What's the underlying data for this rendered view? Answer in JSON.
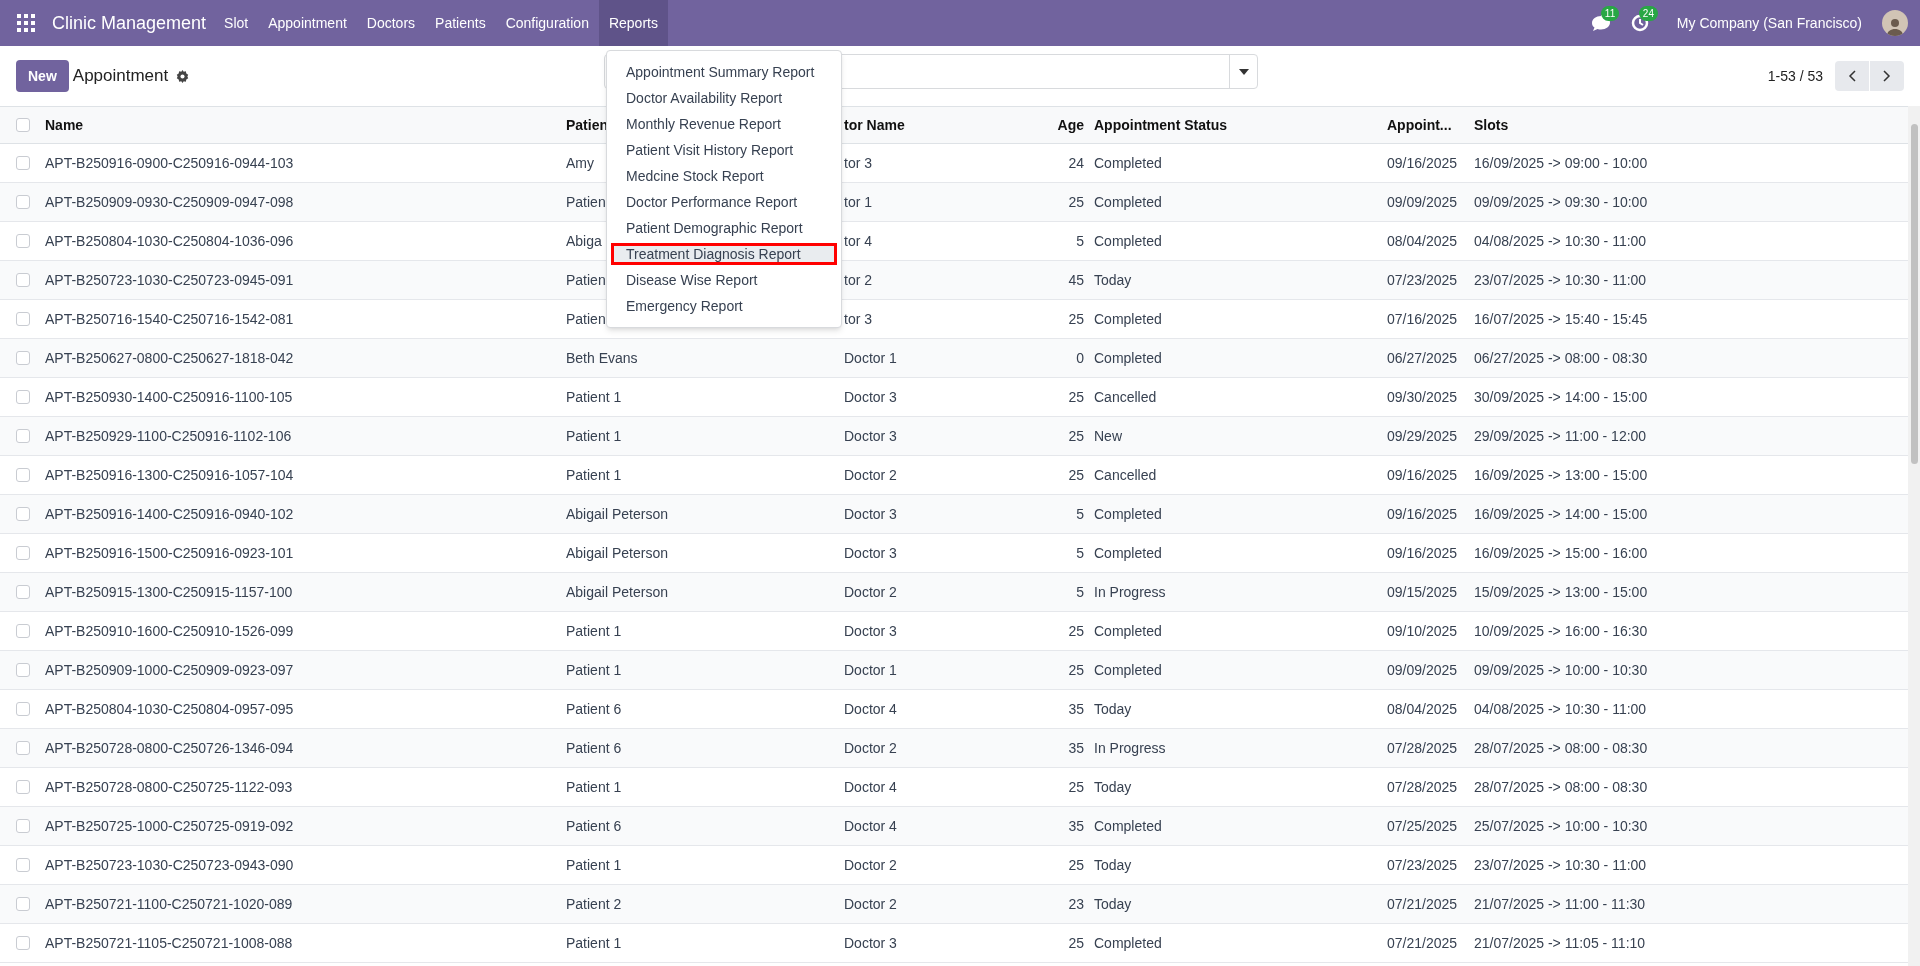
{
  "navbar": {
    "app_name": "Clinic Management",
    "menus": [
      {
        "label": "Slot",
        "selected": false
      },
      {
        "label": "Appointment",
        "selected": false
      },
      {
        "label": "Doctors",
        "selected": false
      },
      {
        "label": "Patients",
        "selected": false
      },
      {
        "label": "Configuration",
        "selected": false
      },
      {
        "label": "Reports",
        "selected": true
      }
    ],
    "messages_count": "11",
    "activities_count": "24",
    "company": "My Company (San Francisco)"
  },
  "reports_menu": {
    "open": true,
    "items": [
      {
        "label": "Appointment Summary Report",
        "selected": false
      },
      {
        "label": "Doctor Availability Report",
        "selected": false
      },
      {
        "label": "Monthly Revenue Report",
        "selected": false
      },
      {
        "label": "Patient Visit History Report",
        "selected": false
      },
      {
        "label": "Medcine Stock Report",
        "selected": false
      },
      {
        "label": "Doctor Performance Report",
        "selected": false
      },
      {
        "label": "Patient Demographic Report",
        "selected": false
      },
      {
        "label": "Treatment Diagnosis Report",
        "selected": true
      },
      {
        "label": "Disease Wise Report",
        "selected": false
      },
      {
        "label": "Emergency Report",
        "selected": false
      }
    ]
  },
  "control_panel": {
    "new_button": "New",
    "breadcrumb": "Appointment",
    "pager": "1-53 / 53"
  },
  "table": {
    "all_checked": false,
    "columns": [
      "Name",
      "Patien",
      "tor Name",
      "Age",
      "Appointment Status",
      "Appoint...",
      "Slots"
    ],
    "rows": [
      {
        "checked": false,
        "cells": [
          "APT-B250916-0900-C250916-0944-103",
          "Amy",
          "tor 3",
          "24",
          "Completed",
          "09/16/2025",
          "16/09/2025 -> 09:00 - 10:00"
        ]
      },
      {
        "checked": false,
        "cells": [
          "APT-B250909-0930-C250909-0947-098",
          "Patien",
          "tor 1",
          "25",
          "Completed",
          "09/09/2025",
          "09/09/2025 -> 09:30 - 10:00"
        ]
      },
      {
        "checked": false,
        "cells": [
          "APT-B250804-1030-C250804-1036-096",
          "Abiga",
          "tor 4",
          "5",
          "Completed",
          "08/04/2025",
          "04/08/2025 -> 10:30 - 11:00"
        ]
      },
      {
        "checked": false,
        "cells": [
          "APT-B250723-1030-C250723-0945-091",
          "Patien",
          "tor 2",
          "45",
          "Today",
          "07/23/2025",
          "23/07/2025 -> 10:30 - 11:00"
        ]
      },
      {
        "checked": false,
        "cells": [
          "APT-B250716-1540-C250716-1542-081",
          "Patien",
          "tor 3",
          "25",
          "Completed",
          "07/16/2025",
          "16/07/2025 -> 15:40 - 15:45"
        ]
      },
      {
        "checked": false,
        "cells": [
          "APT-B250627-0800-C250627-1818-042",
          "Beth Evans",
          "Doctor 1",
          "0",
          "Completed",
          "06/27/2025",
          "06/27/2025 -> 08:00 - 08:30"
        ]
      },
      {
        "checked": false,
        "cells": [
          "APT-B250930-1400-C250916-1100-105",
          "Patient 1",
          "Doctor 3",
          "25",
          "Cancelled",
          "09/30/2025",
          "30/09/2025 -> 14:00 - 15:00"
        ]
      },
      {
        "checked": false,
        "cells": [
          "APT-B250929-1100-C250916-1102-106",
          "Patient 1",
          "Doctor 3",
          "25",
          "New",
          "09/29/2025",
          "29/09/2025 -> 11:00 - 12:00"
        ]
      },
      {
        "checked": false,
        "cells": [
          "APT-B250916-1300-C250916-1057-104",
          "Patient 1",
          "Doctor 2",
          "25",
          "Cancelled",
          "09/16/2025",
          "16/09/2025 -> 13:00 - 15:00"
        ]
      },
      {
        "checked": false,
        "cells": [
          "APT-B250916-1400-C250916-0940-102",
          "Abigail Peterson",
          "Doctor 3",
          "5",
          "Completed",
          "09/16/2025",
          "16/09/2025 -> 14:00 - 15:00"
        ]
      },
      {
        "checked": false,
        "cells": [
          "APT-B250916-1500-C250916-0923-101",
          "Abigail Peterson",
          "Doctor 3",
          "5",
          "Completed",
          "09/16/2025",
          "16/09/2025 -> 15:00 - 16:00"
        ]
      },
      {
        "checked": false,
        "cells": [
          "APT-B250915-1300-C250915-1157-100",
          "Abigail Peterson",
          "Doctor 2",
          "5",
          "In Progress",
          "09/15/2025",
          "15/09/2025 -> 13:00 - 15:00"
        ]
      },
      {
        "checked": false,
        "cells": [
          "APT-B250910-1600-C250910-1526-099",
          "Patient 1",
          "Doctor 3",
          "25",
          "Completed",
          "09/10/2025",
          "10/09/2025 -> 16:00 - 16:30"
        ]
      },
      {
        "checked": false,
        "cells": [
          "APT-B250909-1000-C250909-0923-097",
          "Patient 1",
          "Doctor 1",
          "25",
          "Completed",
          "09/09/2025",
          "09/09/2025 -> 10:00 - 10:30"
        ]
      },
      {
        "checked": false,
        "cells": [
          "APT-B250804-1030-C250804-0957-095",
          "Patient 6",
          "Doctor 4",
          "35",
          "Today",
          "08/04/2025",
          "04/08/2025 -> 10:30 - 11:00"
        ]
      },
      {
        "checked": false,
        "cells": [
          "APT-B250728-0800-C250726-1346-094",
          "Patient 6",
          "Doctor 2",
          "35",
          "In Progress",
          "07/28/2025",
          "28/07/2025 -> 08:00 - 08:30"
        ]
      },
      {
        "checked": false,
        "cells": [
          "APT-B250728-0800-C250725-1122-093",
          "Patient 1",
          "Doctor 4",
          "25",
          "Today",
          "07/28/2025",
          "28/07/2025 -> 08:00 - 08:30"
        ]
      },
      {
        "checked": false,
        "cells": [
          "APT-B250725-1000-C250725-0919-092",
          "Patient 6",
          "Doctor 4",
          "35",
          "Completed",
          "07/25/2025",
          "25/07/2025 -> 10:00 - 10:30"
        ]
      },
      {
        "checked": false,
        "cells": [
          "APT-B250723-1030-C250723-0943-090",
          "Patient 1",
          "Doctor 2",
          "25",
          "Today",
          "07/23/2025",
          "23/07/2025 -> 10:30 - 11:00"
        ]
      },
      {
        "checked": false,
        "cells": [
          "APT-B250721-1100-C250721-1020-089",
          "Patient 2",
          "Doctor 2",
          "23",
          "Today",
          "07/21/2025",
          "21/07/2025 -> 11:00 - 11:30"
        ]
      },
      {
        "checked": false,
        "cells": [
          "APT-B250721-1105-C250721-1008-088",
          "Patient 1",
          "Doctor 3",
          "25",
          "Completed",
          "07/21/2025",
          "21/07/2025 -> 11:05 - 11:10"
        ]
      }
    ]
  }
}
